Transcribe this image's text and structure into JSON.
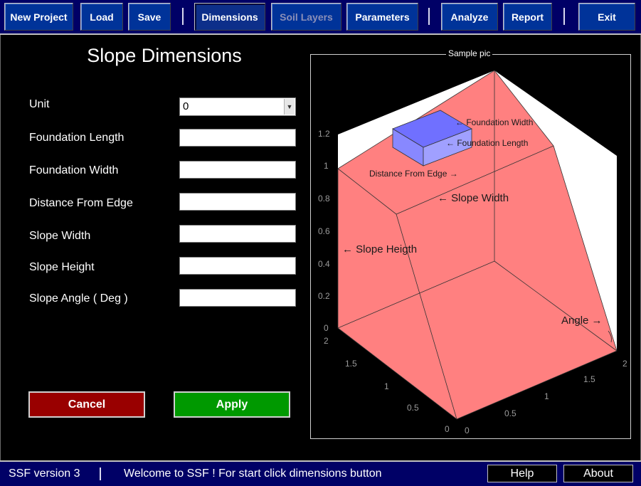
{
  "toolbar": {
    "new_project": "New Project",
    "load": "Load",
    "save": "Save",
    "dimensions": "Dimensions",
    "soil_layers": "Soil Layers",
    "parameters": "Parameters",
    "analyze": "Analyze",
    "report": "Report",
    "exit": "Exit"
  },
  "panel": {
    "title": "Slope Dimensions",
    "unit_label": "Unit",
    "unit_value": "0",
    "fields": [
      {
        "label": "Foundation Length",
        "value": ""
      },
      {
        "label": "Foundation Width",
        "value": ""
      },
      {
        "label": "Distance From Edge",
        "value": ""
      },
      {
        "label": "Slope Width",
        "value": ""
      },
      {
        "label": "Slope Height",
        "value": ""
      },
      {
        "label": "Slope Angle ( Deg )",
        "value": ""
      }
    ],
    "cancel": "Cancel",
    "apply": "Apply"
  },
  "sample": {
    "title": "Sample pic",
    "annotations": {
      "foundation_width": "← Foundation Width",
      "foundation_length": "← Foundation Length",
      "distance_from_edge": "Distance From Edge →",
      "slope_width": "← Slope Width",
      "slope_height": "← Slope Heigth",
      "angle": "Angle →"
    },
    "z_ticks": [
      "0",
      "0.2",
      "0.4",
      "0.6",
      "0.8",
      "1",
      "1.2"
    ],
    "x_ticks": [
      "0",
      "0.5",
      "1",
      "1.5",
      "2"
    ],
    "y_ticks": [
      "0",
      "0.5",
      "1",
      "1.5",
      "2"
    ],
    "colors": {
      "slope_fill": "#ff8080",
      "foundation_fill": "#7070ff",
      "backdrop": "#ffffff"
    }
  },
  "status": {
    "version": "SSF version 3",
    "message": "Welcome to SSF ! For start click dimensions button",
    "help": "Help",
    "about": "About"
  }
}
